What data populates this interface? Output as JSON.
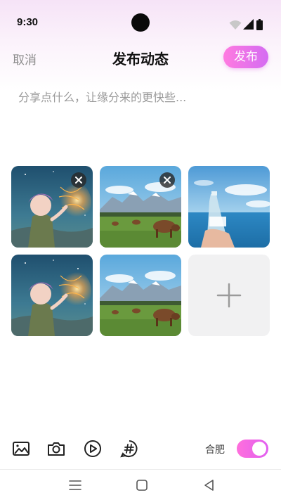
{
  "status_bar": {
    "time": "9:30"
  },
  "header": {
    "cancel_label": "取消",
    "title": "发布动态",
    "publish_label": "发布"
  },
  "composer": {
    "placeholder": "分享点什么，让缘分来的更快些..."
  },
  "photos": [
    {
      "kind": "anime-girl-sparkler",
      "removable": true
    },
    {
      "kind": "mountain-cows",
      "removable": true
    },
    {
      "kind": "bottle-sea",
      "removable": false
    },
    {
      "kind": "anime-girl-sparkler",
      "removable": false
    },
    {
      "kind": "mountain-cows",
      "removable": false
    }
  ],
  "toolbar": {
    "icons": [
      "image-icon",
      "camera-icon",
      "video-play-icon",
      "hashtag-icon"
    ],
    "location_label": "合肥",
    "location_toggle_on": true
  },
  "colors": {
    "accent_start": "#ff7ae0",
    "accent_end": "#d46cf2",
    "placeholder": "#9a9a9a",
    "cancel": "#8c8c8c"
  }
}
